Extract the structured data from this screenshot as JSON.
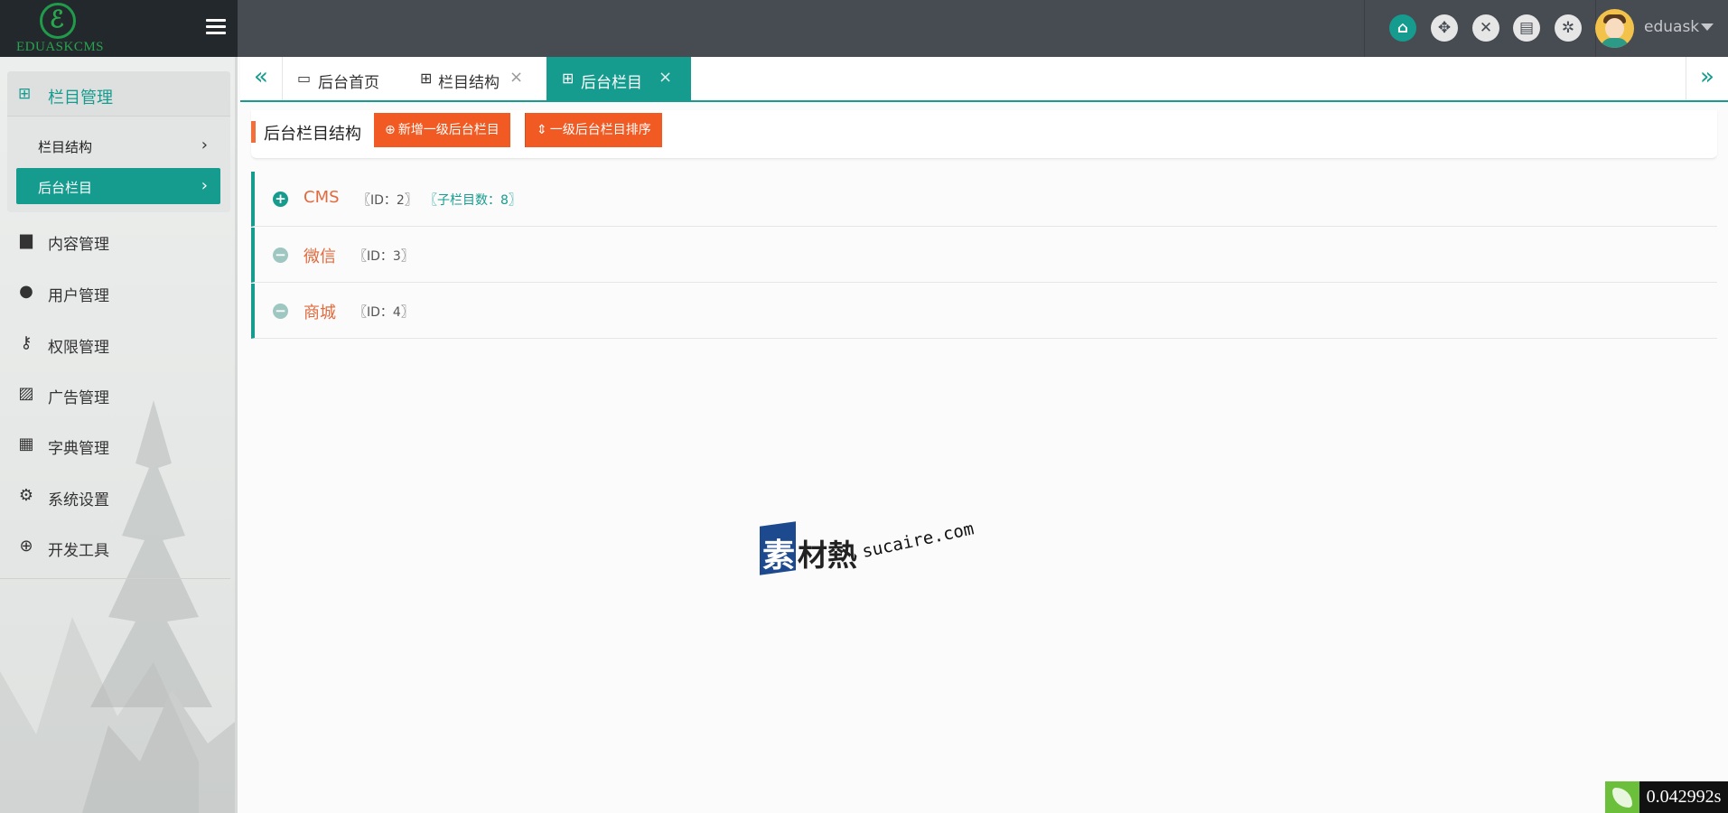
{
  "app": {
    "logo_text": "EDUASKCMS",
    "logo_glyph": "ℰ"
  },
  "header": {
    "tools": [
      {
        "name": "home-icon",
        "glyph": "⌂"
      },
      {
        "name": "move-icon",
        "glyph": "✥"
      },
      {
        "name": "close-all-icon",
        "glyph": "✕"
      },
      {
        "name": "book-icon",
        "glyph": "▤"
      },
      {
        "name": "network-icon",
        "glyph": "✲"
      }
    ],
    "username": "eduask"
  },
  "sidebar": {
    "active_group": {
      "label": "栏目管理",
      "icon": "⊞",
      "items": [
        {
          "label": "栏目结构",
          "chevron": "›"
        },
        {
          "label": "后台栏目",
          "chevron": "›"
        }
      ]
    },
    "items": [
      {
        "label": "内容管理",
        "icon": "▆"
      },
      {
        "label": "用户管理",
        "icon": "●"
      },
      {
        "label": "权限管理",
        "icon": "⚷"
      },
      {
        "label": "广告管理",
        "icon": "▨"
      },
      {
        "label": "字典管理",
        "icon": "▦"
      },
      {
        "label": "系统设置",
        "icon": "⚙"
      },
      {
        "label": "开发工具",
        "icon": "⊕"
      }
    ]
  },
  "tabs": {
    "left_nav": "«",
    "right_nav": "»",
    "items": [
      {
        "label": "后台首页",
        "icon": "▭",
        "close": ""
      },
      {
        "label": "栏目结构",
        "icon": "⊞",
        "close": "×"
      },
      {
        "label": "后台栏目",
        "icon": "⊞",
        "close": "×"
      }
    ]
  },
  "toolbar": {
    "title": "后台栏目结构",
    "add_button": {
      "icon": "⊕",
      "label": "新增一级后台栏目"
    },
    "sort_button": {
      "icon": "⇕",
      "label": "一级后台栏目排序"
    }
  },
  "tree": [
    {
      "toggle": "+",
      "name": "CMS",
      "id_text": "〖ID：2〗",
      "children_text": "〖子栏目数：8〗"
    },
    {
      "toggle": "−",
      "name": "微信",
      "id_text": "〖ID：3〗",
      "children_text": ""
    },
    {
      "toggle": "−",
      "name": "商城",
      "id_text": "〖ID：4〗",
      "children_text": ""
    }
  ],
  "watermark": {
    "char": "素",
    "text": "材熱",
    "domain": "sucaire.com"
  },
  "timer": "0.042992s",
  "colors": {
    "accent": "#169c8f",
    "orange": "#f15a22",
    "header": "#474b52",
    "logo_bg": "#23282d"
  }
}
